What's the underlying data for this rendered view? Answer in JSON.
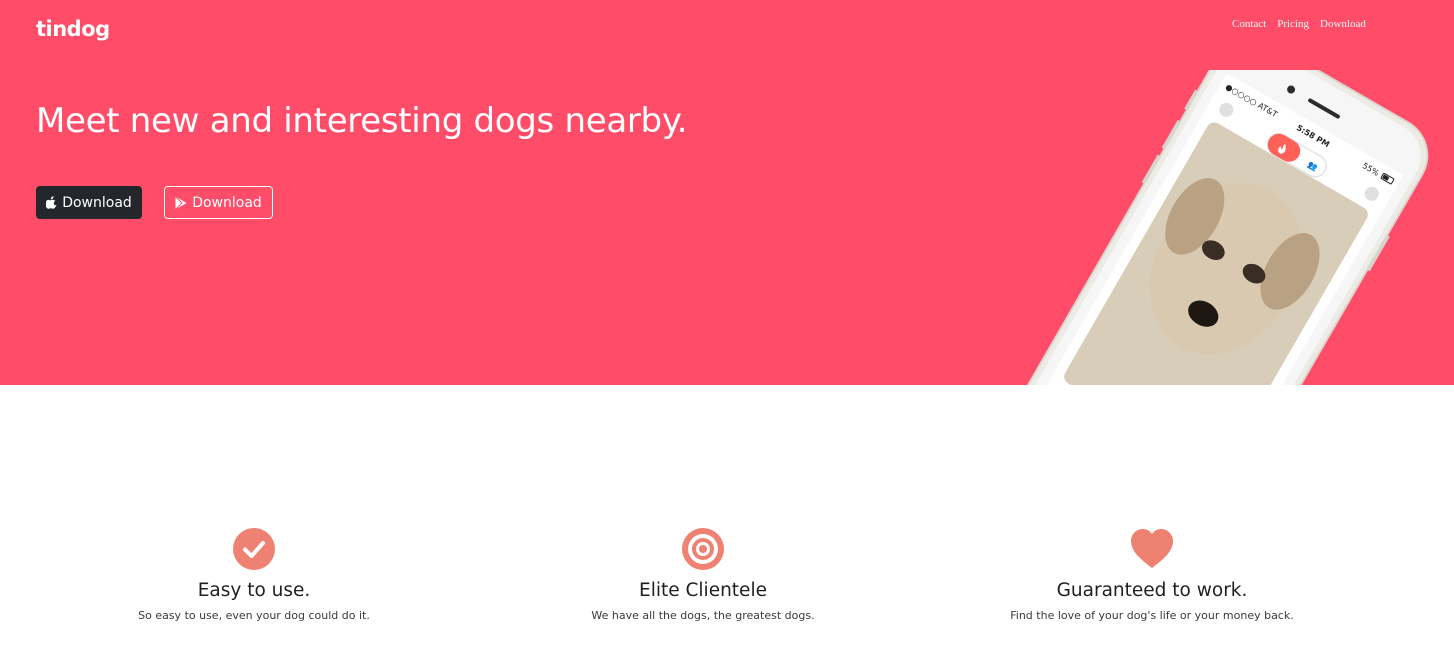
{
  "brand": {
    "name": "tindog"
  },
  "nav": {
    "items": [
      "Contact",
      "Pricing",
      "Download"
    ]
  },
  "hero": {
    "headline": "Meet new and interesting dogs nearby.",
    "apple_button_label": "Download",
    "play_button_label": "Download"
  },
  "phone": {
    "carrier": "●○○○○ AT&T",
    "time": "5:58 PM",
    "battery": "55%"
  },
  "features": [
    {
      "icon": "check-circle-icon",
      "title": "Easy to use.",
      "text": "So easy to use, even your dog could do it."
    },
    {
      "icon": "bullseye-icon",
      "title": "Elite Clientele",
      "text": "We have all the dogs, the greatest dogs."
    },
    {
      "icon": "heart-icon",
      "title": "Guaranteed to work.",
      "text": "Find the love of your dog's life or your money back."
    }
  ],
  "colors": {
    "hero_bg": "#ff4c68",
    "icon_accent": "#ef8172",
    "dark_button": "#23262b"
  }
}
